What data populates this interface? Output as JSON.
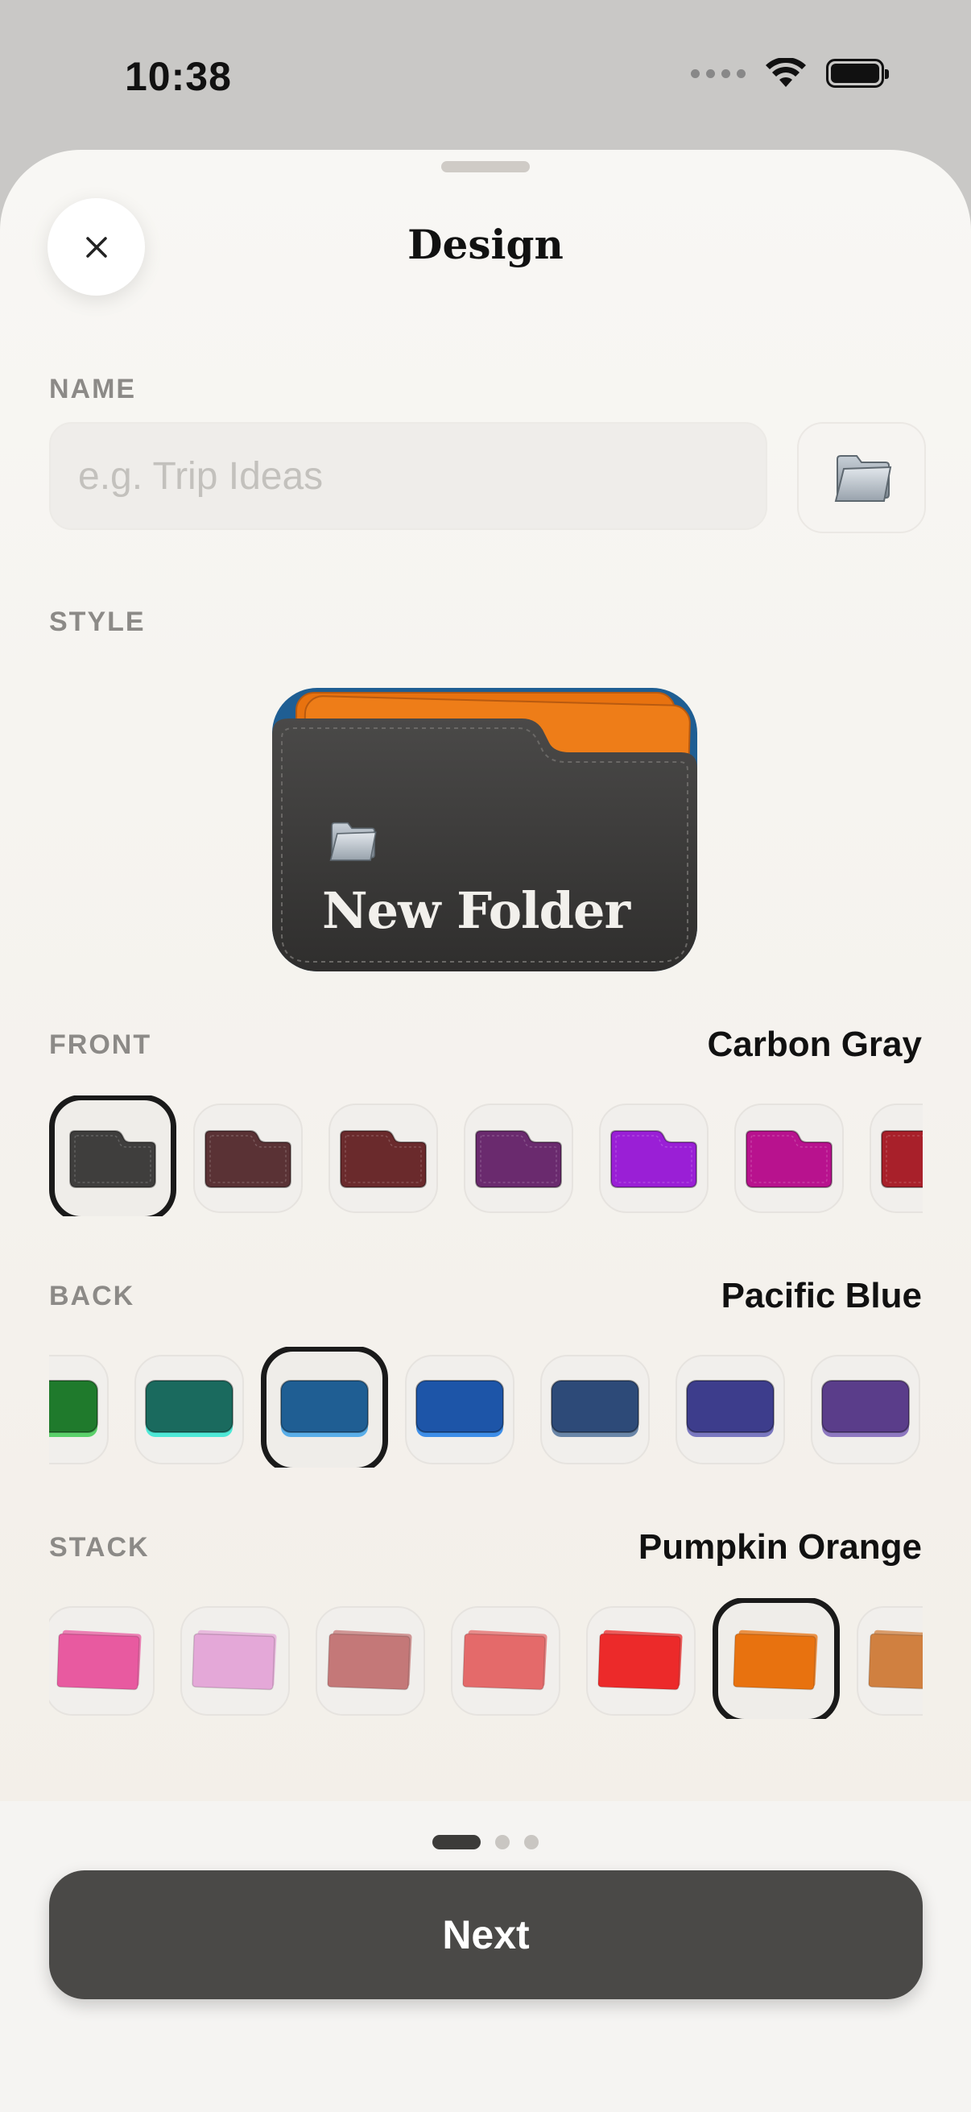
{
  "status": {
    "time": "10:38"
  },
  "sheet": {
    "title": "Design"
  },
  "name": {
    "label": "NAME",
    "placeholder": "e.g. Trip Ideas",
    "value": ""
  },
  "style": {
    "label": "STYLE",
    "preview_title": "New Folder",
    "front_color": "#3d3c3b",
    "back_color": "#1f5e93",
    "stack_color": "#e8720f"
  },
  "front": {
    "label": "FRONT",
    "selected_name": "Carbon Gray",
    "colors": [
      "#3f3e3d",
      "#5a3235",
      "#6a2a2c",
      "#6a2a6e",
      "#9a1fd6",
      "#b8128e",
      "#a8202a"
    ],
    "selected_index": 0
  },
  "back": {
    "label": "BACK",
    "selected_name": "Pacific Blue",
    "colors": [
      "#1f7a2c",
      "#1a6a5e",
      "#1f5e93",
      "#1d55a8",
      "#2d4a78",
      "#3d3d8c",
      "#5a3d8a"
    ],
    "accent_colors": [
      "#5bd06a",
      "#4ee8d6",
      "#5aaee8",
      "#3e8ee8",
      "#6a86a8",
      "#7a78c0",
      "#8e78c0"
    ],
    "selected_index": 2
  },
  "stack": {
    "label": "STACK",
    "selected_name": "Pumpkin Orange",
    "colors": [
      "#e85aa0",
      "#e4a8d8",
      "#c47878",
      "#e46a6a",
      "#ec2a2a",
      "#e8720f",
      "#d08040"
    ],
    "selected_index": 5
  },
  "pager": {
    "count": 3,
    "active": 0
  },
  "next_label": "Next"
}
